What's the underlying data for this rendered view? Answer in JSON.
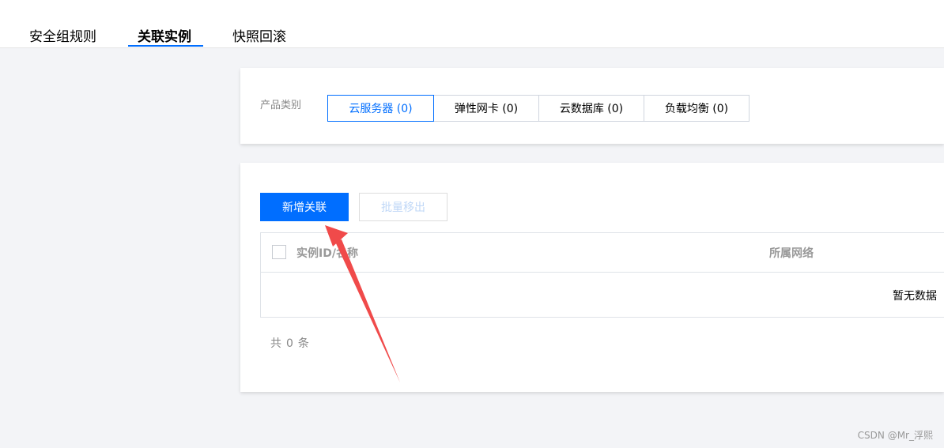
{
  "tabs": {
    "items": [
      {
        "label": "安全组规则"
      },
      {
        "label": "关联实例"
      },
      {
        "label": "快照回滚"
      }
    ],
    "active_index": 1
  },
  "filter": {
    "label": "产品类别",
    "options": [
      {
        "label": "云服务器 (0)"
      },
      {
        "label": "弹性网卡 (0)"
      },
      {
        "label": "云数据库 (0)"
      },
      {
        "label": "负载均衡 (0)"
      }
    ],
    "selected_index": 0
  },
  "actions": {
    "add_label": "新增关联",
    "remove_label": "批量移出"
  },
  "table": {
    "columns": [
      "实例ID/名称",
      "所属网络"
    ],
    "empty_text": "暂无数据"
  },
  "pagination": {
    "prefix": "共",
    "count": "0",
    "suffix": "条"
  },
  "watermark": "CSDN @Mr_浮熙",
  "colors": {
    "accent": "#006eff",
    "annotation": "#f04a4a"
  }
}
